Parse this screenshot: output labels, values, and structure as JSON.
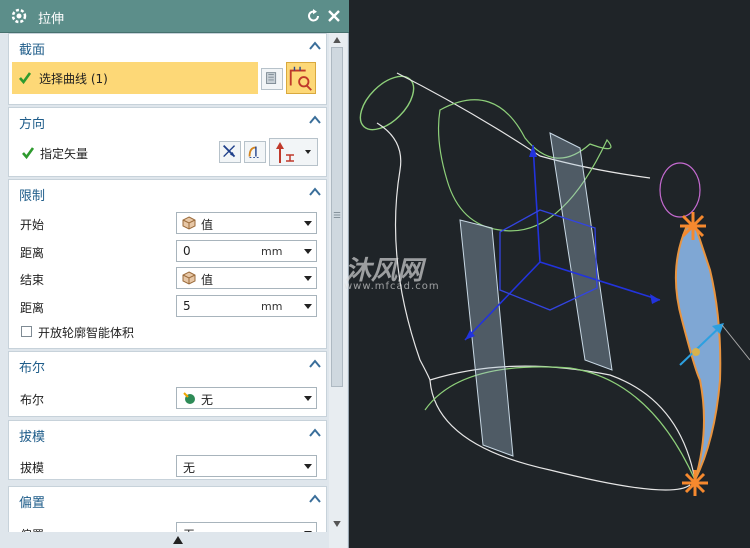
{
  "dialog": {
    "title": "拉伸",
    "sections": {
      "section": {
        "title": "截面",
        "select_curve_label": "选择曲线 (1)"
      },
      "direction": {
        "title": "方向",
        "specify_vector_label": "指定矢量"
      },
      "limits": {
        "title": "限制",
        "start_label": "开始",
        "start_value": "值",
        "distance1_label": "距离",
        "distance1_value": "0",
        "distance1_unit": "mm",
        "end_label": "结束",
        "end_value": "值",
        "distance2_label": "距离",
        "distance2_value": "5",
        "distance2_unit": "mm",
        "open_profile_label": "开放轮廓智能体积"
      },
      "boolean": {
        "title": "布尔",
        "label": "布尔",
        "value": "无"
      },
      "draft": {
        "title": "拔模",
        "label": "拔模",
        "value": "无"
      },
      "offset": {
        "title": "偏置",
        "label": "偏置",
        "value": "无"
      }
    }
  },
  "watermark": {
    "brand": "沐风网",
    "url": "www.mfcad.com"
  },
  "colors": {
    "title_bar": "#5c8e8a",
    "section_title": "#1f5d8a",
    "highlight_row": "#fdd877",
    "viewport_bg": "#1f2428"
  }
}
